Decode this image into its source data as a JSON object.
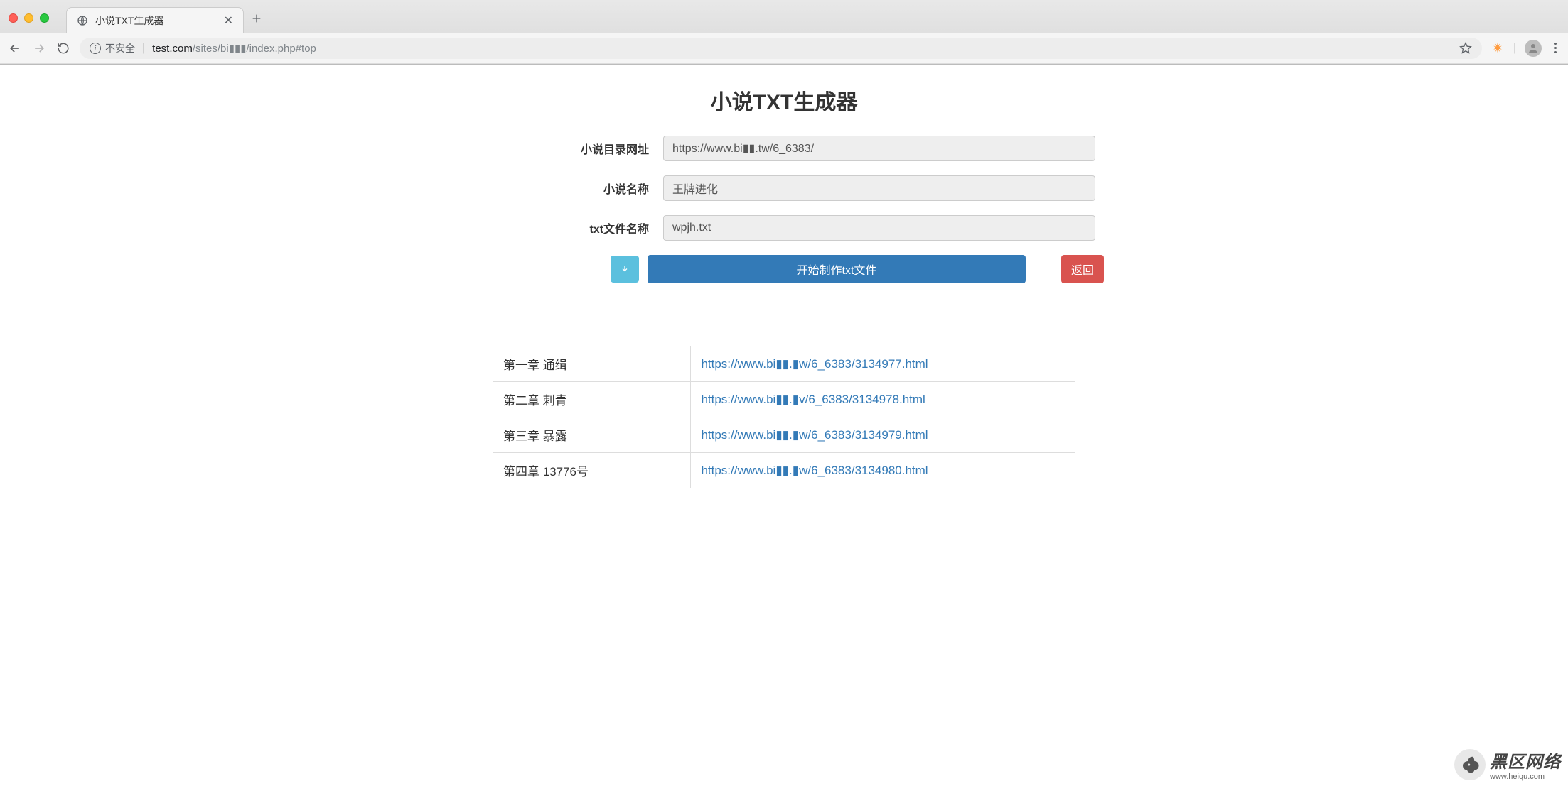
{
  "browser": {
    "tab_title": "小说TXT生成器",
    "url_insecure_label": "不安全",
    "url_host": "test.com",
    "url_path_prefix": "/sites/bi",
    "url_path_suffix": "/index.php#top"
  },
  "page": {
    "title": "小说TXT生成器",
    "form": {
      "url_label": "小说目录网址",
      "url_value": "https://www.bi▮▮.tw/6_6383/",
      "name_label": "小说名称",
      "name_value": "王牌进化",
      "txt_label": "txt文件名称",
      "txt_value": "wpjh.txt",
      "start_button": "开始制作txt文件",
      "back_button": "返回"
    },
    "chapters": [
      {
        "title": "第一章 通缉",
        "link": "https://www.bi▮▮.▮w/6_6383/3134977.html"
      },
      {
        "title": "第二章 刺青",
        "link": "https://www.bi▮▮.▮v/6_6383/3134978.html"
      },
      {
        "title": "第三章 暴露",
        "link": "https://www.bi▮▮.▮w/6_6383/3134979.html"
      },
      {
        "title": "第四章 13776号",
        "link": "https://www.bi▮▮.▮w/6_6383/3134980.html"
      }
    ]
  },
  "watermark": {
    "cn": "黑区网络",
    "en": "www.heiqu.com"
  }
}
